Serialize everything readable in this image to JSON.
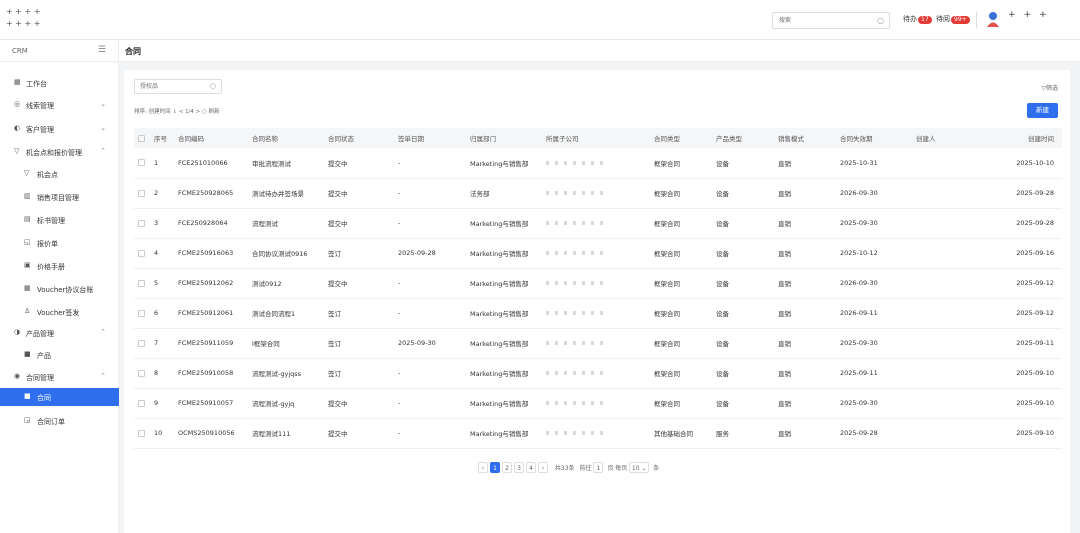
{
  "topbar": {
    "search_placeholder": "搜索",
    "todo_label": "待办",
    "todo_count": "17",
    "read_label": "待阅",
    "read_count": "99+"
  },
  "sidebar": {
    "title": "CRM",
    "items": [
      {
        "label": "工作台",
        "icon": "grid-icon"
      },
      {
        "label": "线索管理",
        "icon": "lead-icon"
      },
      {
        "label": "客户管理",
        "icon": "customer-icon"
      },
      {
        "label": "机会点和报价管理",
        "icon": "filter-icon"
      },
      {
        "label": "机会点",
        "icon": "funnel-icon"
      },
      {
        "label": "销售项目管理",
        "icon": "project-icon"
      },
      {
        "label": "标书管理",
        "icon": "doc-icon"
      },
      {
        "label": "报价单",
        "icon": "quote-icon"
      },
      {
        "label": "价格手册",
        "icon": "book-icon"
      },
      {
        "label": "Voucher协议台账",
        "icon": "ledger-icon"
      },
      {
        "label": "Voucher签发",
        "icon": "stamp-icon"
      },
      {
        "label": "产品管理",
        "icon": "product-icon"
      },
      {
        "label": "产品",
        "icon": "box-icon"
      },
      {
        "label": "合同管理",
        "icon": "contract-icon"
      },
      {
        "label": "合同",
        "icon": "contract-doc-icon"
      },
      {
        "label": "合同订单",
        "icon": "order-icon"
      }
    ]
  },
  "page_title": "合同",
  "filter": {
    "placeholder": "授权品",
    "filter_label": "筛选",
    "sort_text": "排序: 创建时间 ⇂   < 1/4 >   ○ 刷新",
    "new_button": "新建"
  },
  "table": {
    "headers": [
      "序号",
      "合同编码",
      "合同名称",
      "合同状态",
      "签单日期",
      "归属部门",
      "所属子公司",
      "合同类型",
      "产品类型",
      "销售模式",
      "合同失效期",
      "创建人",
      "创建时间"
    ],
    "rows": [
      [
        "1",
        "FCE251010066",
        "审批流程测试",
        "提交中",
        "-",
        "Marketing与销售部",
        "框架合同",
        "设备",
        "直销",
        "2025-10-31",
        "2025-10-10"
      ],
      [
        "2",
        "FCME250928065",
        "测试待办并签场景",
        "提交中",
        "-",
        "法务部",
        "框架合同",
        "设备",
        "直销",
        "2026-09-30",
        "2025-09-28"
      ],
      [
        "3",
        "FCE250928064",
        "流程测试",
        "提交中",
        "-",
        "Marketing与销售部",
        "框架合同",
        "设备",
        "直销",
        "2025-09-30",
        "2025-09-28"
      ],
      [
        "4",
        "FCME250916063",
        "合同协议测试0916",
        "签订",
        "2025-09-28",
        "Marketing与销售部",
        "框架合同",
        "设备",
        "直销",
        "2025-10-12",
        "2025-09-16"
      ],
      [
        "5",
        "FCME250912062",
        "测试0912",
        "提交中",
        "-",
        "Marketing与销售部",
        "框架合同",
        "设备",
        "直销",
        "2026-09-30",
        "2025-09-12"
      ],
      [
        "6",
        "FCME250912061",
        "测试合同流程1",
        "签订",
        "-",
        "Marketing与销售部",
        "框架合同",
        "设备",
        "直销",
        "2026-09-11",
        "2025-09-12"
      ],
      [
        "7",
        "FCME250911059",
        "l框架合同",
        "签订",
        "2025-09-30",
        "Marketing与销售部",
        "框架合同",
        "设备",
        "直销",
        "2025-09-30",
        "2025-09-11"
      ],
      [
        "8",
        "FCME250910058",
        "流程测试-gyjqss",
        "签订",
        "-",
        "Marketing与销售部",
        "框架合同",
        "设备",
        "直销",
        "2025-09-11",
        "2025-09-10"
      ],
      [
        "9",
        "FCME250910057",
        "流程测试-gyjq",
        "提交中",
        "-",
        "Marketing与销售部",
        "框架合同",
        "设备",
        "直销",
        "2025-09-30",
        "2025-09-10"
      ],
      [
        "10",
        "OCMS250910056",
        "流程测试111",
        "提交中",
        "-",
        "Marketing与销售部",
        "其他基础合同",
        "服务",
        "直销",
        "2025-09-28",
        "2025-09-10"
      ]
    ]
  },
  "pagination": {
    "pages": [
      "1",
      "2",
      "3",
      "4"
    ],
    "total": "共33条",
    "goto": "前往",
    "goto_value": "1",
    "page_unit": "页",
    "per_page_label": "每页",
    "per_page": "10",
    "per_page_unit": "条"
  }
}
